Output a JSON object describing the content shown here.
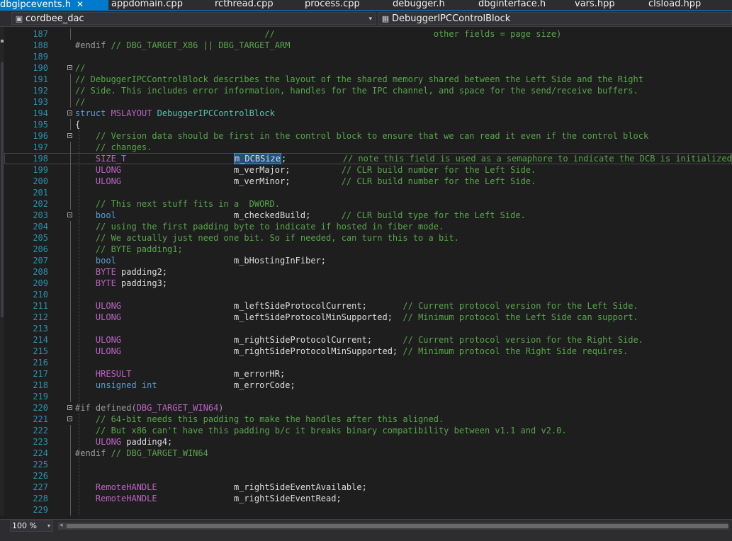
{
  "tabs": [
    {
      "label": "dbgipcevents.h",
      "close": "✕",
      "active": true
    },
    {
      "label": "appdomain.cpp"
    },
    {
      "label": "rcthread.cpp"
    },
    {
      "label": "process.cpp"
    },
    {
      "label": "debugger.h"
    },
    {
      "label": "dbginterface.h"
    },
    {
      "label": "vars.hpp"
    },
    {
      "label": "clsload.hpp"
    }
  ],
  "navbar": {
    "project": "cordbee_dac",
    "scope": "DebuggerIPCControlBlock",
    "dropdown_glyph": "▾",
    "project_icon": "project-icon",
    "scope_icon": "struct-icon"
  },
  "editor": {
    "current_line": "198",
    "selected_text": "m_DCBSize",
    "lines": [
      {
        "n": "187",
        "fold": false,
        "guide": true,
        "s": [
          [
            "",
            "                                     "
          ],
          [
            "c",
            "//                               other fields = page size)"
          ]
        ]
      },
      {
        "n": "188",
        "fold": false,
        "guide": false,
        "s": [
          [
            "pp",
            "#endif"
          ],
          [
            "c",
            " // DBG_TARGET_X86 || DBG_TARGET_ARM"
          ]
        ]
      },
      {
        "n": "189",
        "fold": false,
        "guide": false,
        "s": []
      },
      {
        "n": "190",
        "fold": true,
        "guide": false,
        "s": [
          [
            "c",
            "//"
          ]
        ]
      },
      {
        "n": "191",
        "fold": false,
        "guide": true,
        "s": [
          [
            "c",
            "// DebuggerIPCControlBlock describes the layout of the shared memory shared between the Left Side and the Right"
          ]
        ]
      },
      {
        "n": "192",
        "fold": false,
        "guide": true,
        "s": [
          [
            "c",
            "// Side. This includes error information, handles for the IPC channel, and space for the send/receive buffers."
          ]
        ]
      },
      {
        "n": "193",
        "fold": false,
        "guide": true,
        "s": [
          [
            "c",
            "//"
          ]
        ]
      },
      {
        "n": "194",
        "fold": true,
        "guide": false,
        "s": [
          [
            "k",
            "struct"
          ],
          [
            "",
            " "
          ],
          [
            "m",
            "MSLAYOUT"
          ],
          [
            "",
            " "
          ],
          [
            "t",
            "DebuggerIPCControlBlock"
          ]
        ]
      },
      {
        "n": "195",
        "fold": false,
        "guide": true,
        "s": [
          [
            "",
            "{"
          ]
        ]
      },
      {
        "n": "196",
        "fold": true,
        "guide": false,
        "s": [
          [
            "",
            "    "
          ],
          [
            "c",
            "// Version data should be first in the control block to ensure that we can read it even if the control block"
          ]
        ]
      },
      {
        "n": "197",
        "fold": false,
        "guide": true,
        "s": [
          [
            "",
            "    "
          ],
          [
            "c",
            "// changes."
          ]
        ]
      },
      {
        "n": "198",
        "fold": false,
        "guide": true,
        "s": [
          [
            "",
            "    "
          ],
          [
            "m",
            "SIZE_T"
          ],
          [
            "",
            "                     "
          ],
          [
            "sel",
            "m_DCBSize"
          ],
          [
            "",
            ";           "
          ],
          [
            "c",
            "// note this field is used as a semaphore to indicate the DCB is initialized"
          ]
        ]
      },
      {
        "n": "199",
        "fold": false,
        "guide": true,
        "s": [
          [
            "",
            "    "
          ],
          [
            "m",
            "ULONG"
          ],
          [
            "",
            "                      m_verMajor;          "
          ],
          [
            "c",
            "// CLR build number for the Left Side."
          ]
        ]
      },
      {
        "n": "200",
        "fold": false,
        "guide": true,
        "s": [
          [
            "",
            "    "
          ],
          [
            "m",
            "ULONG"
          ],
          [
            "",
            "                      m_verMinor;          "
          ],
          [
            "c",
            "// CLR build number for the Left Side."
          ]
        ]
      },
      {
        "n": "201",
        "fold": false,
        "guide": true,
        "s": []
      },
      {
        "n": "202",
        "fold": false,
        "guide": true,
        "s": [
          [
            "",
            "    "
          ],
          [
            "c",
            "// This next stuff fits in a  DWORD."
          ]
        ]
      },
      {
        "n": "203",
        "fold": true,
        "guide": false,
        "s": [
          [
            "",
            "    "
          ],
          [
            "k",
            "bool"
          ],
          [
            "",
            "                       m_checkedBuild;      "
          ],
          [
            "c",
            "// CLR build type for the Left Side."
          ]
        ]
      },
      {
        "n": "204",
        "fold": false,
        "guide": true,
        "s": [
          [
            "",
            "    "
          ],
          [
            "c",
            "// using the first padding byte to indicate if hosted in fiber mode."
          ]
        ]
      },
      {
        "n": "205",
        "fold": false,
        "guide": true,
        "s": [
          [
            "",
            "    "
          ],
          [
            "c",
            "// We actually just need one bit. So if needed, can turn this to a bit."
          ]
        ]
      },
      {
        "n": "206",
        "fold": false,
        "guide": true,
        "s": [
          [
            "",
            "    "
          ],
          [
            "c",
            "// BYTE padding1;"
          ]
        ]
      },
      {
        "n": "207",
        "fold": false,
        "guide": true,
        "s": [
          [
            "",
            "    "
          ],
          [
            "k",
            "bool"
          ],
          [
            "",
            "                       m_bHostingInFiber;"
          ]
        ]
      },
      {
        "n": "208",
        "fold": false,
        "guide": true,
        "s": [
          [
            "",
            "    "
          ],
          [
            "m",
            "BYTE"
          ],
          [
            "",
            " padding2;"
          ]
        ]
      },
      {
        "n": "209",
        "fold": false,
        "guide": true,
        "s": [
          [
            "",
            "    "
          ],
          [
            "m",
            "BYTE"
          ],
          [
            "",
            " padding3;"
          ]
        ]
      },
      {
        "n": "210",
        "fold": false,
        "guide": true,
        "s": []
      },
      {
        "n": "211",
        "fold": false,
        "guide": true,
        "s": [
          [
            "",
            "    "
          ],
          [
            "m",
            "ULONG"
          ],
          [
            "",
            "                      m_leftSideProtocolCurrent;       "
          ],
          [
            "c",
            "// Current protocol version for the Left Side."
          ]
        ]
      },
      {
        "n": "212",
        "fold": false,
        "guide": true,
        "s": [
          [
            "",
            "    "
          ],
          [
            "m",
            "ULONG"
          ],
          [
            "",
            "                      m_leftSideProtocolMinSupported;  "
          ],
          [
            "c",
            "// Minimum protocol the Left Side can support."
          ]
        ]
      },
      {
        "n": "213",
        "fold": false,
        "guide": true,
        "s": []
      },
      {
        "n": "214",
        "fold": false,
        "guide": true,
        "s": [
          [
            "",
            "    "
          ],
          [
            "m",
            "ULONG"
          ],
          [
            "",
            "                      m_rightSideProtocolCurrent;      "
          ],
          [
            "c",
            "// Current protocol version for the Right Side."
          ]
        ]
      },
      {
        "n": "215",
        "fold": false,
        "guide": true,
        "s": [
          [
            "",
            "    "
          ],
          [
            "m",
            "ULONG"
          ],
          [
            "",
            "                      m_rightSideProtocolMinSupported; "
          ],
          [
            "c",
            "// Minimum protocol the Right Side requires."
          ]
        ]
      },
      {
        "n": "216",
        "fold": false,
        "guide": true,
        "s": []
      },
      {
        "n": "217",
        "fold": false,
        "guide": true,
        "s": [
          [
            "",
            "    "
          ],
          [
            "m",
            "HRESULT"
          ],
          [
            "",
            "                    m_errorHR;"
          ]
        ]
      },
      {
        "n": "218",
        "fold": false,
        "guide": true,
        "s": [
          [
            "",
            "    "
          ],
          [
            "k",
            "unsigned int"
          ],
          [
            "",
            "               m_errorCode;"
          ]
        ]
      },
      {
        "n": "219",
        "fold": false,
        "guide": true,
        "s": []
      },
      {
        "n": "220",
        "fold": true,
        "guide": false,
        "s": [
          [
            "pp",
            "#if defined("
          ],
          [
            "m",
            "DBG_TARGET_WIN64"
          ],
          [
            "pp",
            ")"
          ]
        ]
      },
      {
        "n": "221",
        "fold": true,
        "guide": false,
        "s": [
          [
            "",
            "    "
          ],
          [
            "c",
            "// 64-bit needs this padding to make the handles after this aligned."
          ]
        ]
      },
      {
        "n": "222",
        "fold": false,
        "guide": true,
        "s": [
          [
            "",
            "    "
          ],
          [
            "c",
            "// But x86 can't have this padding b/c it breaks binary compatibility between v1.1 and v2.0."
          ]
        ]
      },
      {
        "n": "223",
        "fold": false,
        "guide": true,
        "s": [
          [
            "",
            "    "
          ],
          [
            "m",
            "ULONG"
          ],
          [
            "",
            " padding4;"
          ]
        ]
      },
      {
        "n": "224",
        "fold": false,
        "guide": true,
        "s": [
          [
            "pp",
            "#endif"
          ],
          [
            "c",
            " // DBG_TARGET_WIN64"
          ]
        ]
      },
      {
        "n": "225",
        "fold": false,
        "guide": true,
        "s": []
      },
      {
        "n": "226",
        "fold": false,
        "guide": true,
        "s": []
      },
      {
        "n": "227",
        "fold": false,
        "guide": true,
        "s": [
          [
            "",
            "    "
          ],
          [
            "m",
            "RemoteHANDLE"
          ],
          [
            "",
            "               m_rightSideEventAvailable;"
          ]
        ]
      },
      {
        "n": "228",
        "fold": false,
        "guide": true,
        "s": [
          [
            "",
            "    "
          ],
          [
            "m",
            "RemoteHANDLE"
          ],
          [
            "",
            "               m_rightSideEventRead;"
          ]
        ]
      },
      {
        "n": "229",
        "fold": false,
        "guide": true,
        "s": []
      }
    ]
  },
  "status": {
    "zoom": "100 %",
    "zoom_arrow": "▾",
    "scroll_left_glyph": "◂"
  },
  "colors": {
    "keyword": "#569cd6",
    "comment": "#57a64a",
    "macro": "#bd63c5",
    "type": "#4ec9b0",
    "line_number": "#2b91af",
    "tab_active": "#007acc"
  }
}
